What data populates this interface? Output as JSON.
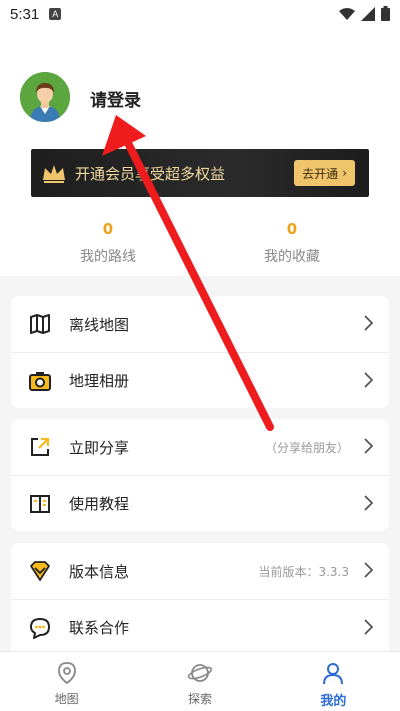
{
  "status_bar": {
    "time": "5:31",
    "notification_icon": "A"
  },
  "profile": {
    "login_text": "请登录"
  },
  "vip": {
    "text": "开通会员享受超多权益",
    "button_label": "去开通",
    "button_chevron": "›"
  },
  "stats": [
    {
      "value": "0",
      "label": "我的路线"
    },
    {
      "value": "0",
      "label": "我的收藏"
    }
  ],
  "menu_group1": [
    {
      "label": "离线地图",
      "icon": "map-icon"
    },
    {
      "label": "地理相册",
      "icon": "camera-icon"
    }
  ],
  "menu_group2": [
    {
      "label": "立即分享",
      "hint": "（分享给朋友）",
      "icon": "share-icon"
    },
    {
      "label": "使用教程",
      "icon": "book-icon"
    }
  ],
  "menu_group3": [
    {
      "label": "版本信息",
      "hint": "当前版本：3.3.3",
      "icon": "diamond-icon"
    },
    {
      "label": "联系合作",
      "icon": "chat-icon"
    }
  ],
  "bottom_nav": [
    {
      "label": "地图",
      "icon": "map-pin-icon",
      "active": false
    },
    {
      "label": "探索",
      "icon": "planet-icon",
      "active": false
    },
    {
      "label": "我的",
      "icon": "person-icon",
      "active": true
    }
  ],
  "colors": {
    "accent": "#2c6cd6",
    "stat_number": "#f0a11c",
    "vip_gold": "#f0c46a",
    "arrow": "#ee1c1c"
  }
}
